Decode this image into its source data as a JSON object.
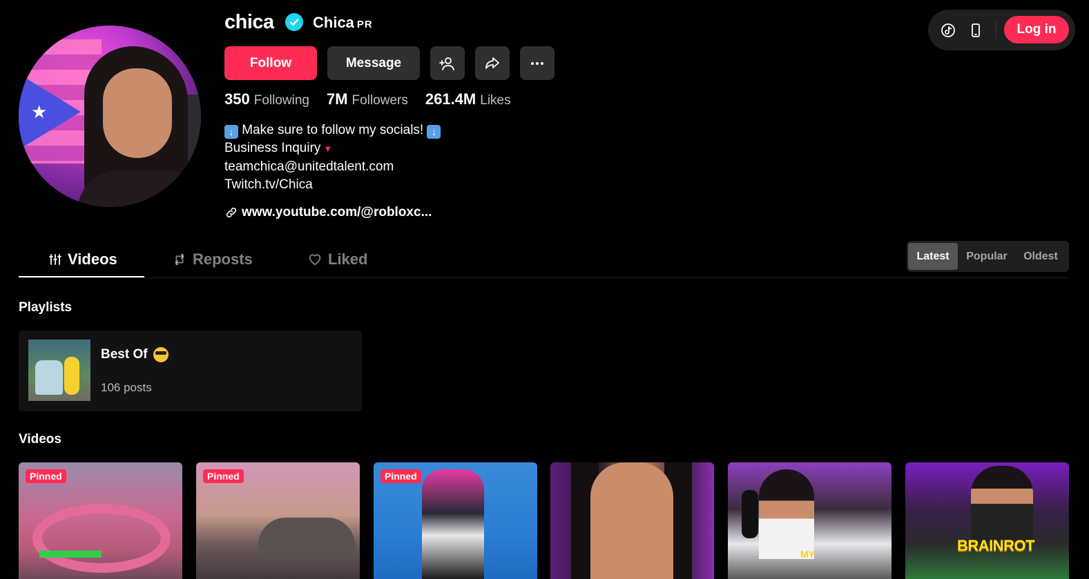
{
  "profile": {
    "username": "chica",
    "nickname": "Chica",
    "badge": "PR",
    "follow_label": "Follow",
    "message_label": "Message",
    "stats": [
      {
        "value": "350",
        "label": "Following"
      },
      {
        "value": "7M",
        "label": "Followers"
      },
      {
        "value": "261.4M",
        "label": "Likes"
      }
    ],
    "bio": {
      "line1": "Make sure to follow my socials!",
      "line2": "Business Inquiry",
      "line3": "teamchica@unitedtalent.com",
      "line4": "Twitch.tv/Chica"
    },
    "link": "www.youtube.com/@robloxc..."
  },
  "topbar": {
    "login_label": "Log in",
    "icons": [
      "tiktok-coin-icon",
      "mobile-device-icon"
    ]
  },
  "tabs": [
    {
      "label": "Videos",
      "active": true
    },
    {
      "label": "Reposts",
      "active": false
    },
    {
      "label": "Liked",
      "active": false
    }
  ],
  "sort": {
    "options": [
      "Latest",
      "Popular",
      "Oldest"
    ],
    "selected": "Latest"
  },
  "playlists": {
    "heading": "Playlists",
    "items": [
      {
        "title": "Best Of",
        "count": "106 posts"
      }
    ]
  },
  "videos": {
    "heading": "Videos",
    "pinned_label": "Pinned",
    "items": [
      {
        "pinned": true,
        "caption": ""
      },
      {
        "pinned": true,
        "caption": ""
      },
      {
        "pinned": true,
        "caption": ""
      },
      {
        "pinned": false,
        "caption": ""
      },
      {
        "pinned": false,
        "caption": "MY"
      },
      {
        "pinned": false,
        "caption": "BRAINROT"
      }
    ]
  },
  "colors": {
    "accent": "#fe2c55",
    "verified": "#20d5ec",
    "button_dark": "#2f2f2f",
    "background": "#000000"
  }
}
